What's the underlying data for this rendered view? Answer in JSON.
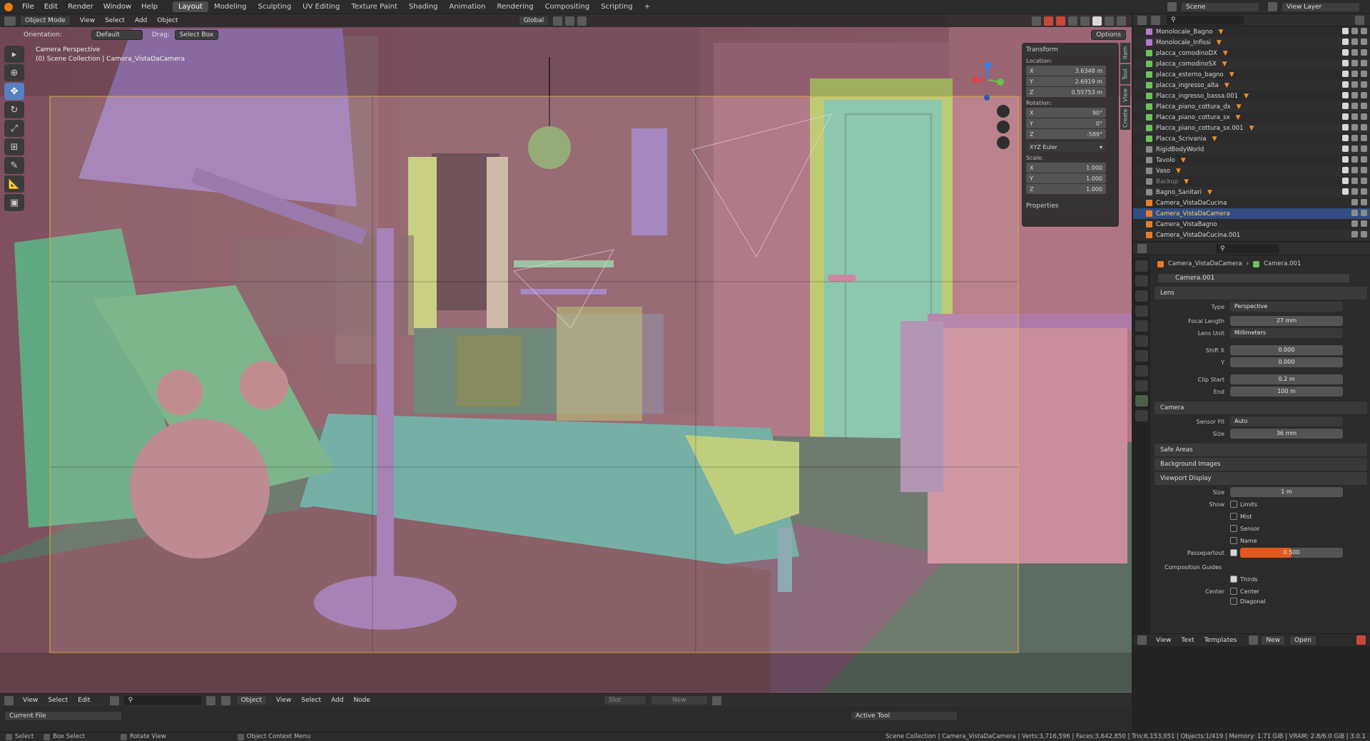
{
  "topbar": {
    "menus": [
      "File",
      "Edit",
      "Render",
      "Window",
      "Help"
    ],
    "workspaces": [
      "Layout",
      "Modeling",
      "Sculpting",
      "UV Editing",
      "Texture Paint",
      "Shading",
      "Animation",
      "Rendering",
      "Compositing",
      "Scripting"
    ],
    "active_workspace": "Layout",
    "add_tab": "+",
    "scene_label": "Scene",
    "view_layer_label": "View Layer"
  },
  "viewport_header": {
    "mode": "Object Mode",
    "menus": [
      "View",
      "Select",
      "Add",
      "Object"
    ],
    "transform_orientation": "Global",
    "orientation_label": "Orientation:",
    "orientation_value": "Default",
    "drag_label": "Drag:",
    "drag_value": "Select Box",
    "options": "Options"
  },
  "viewport": {
    "camera_view": "Camera Perspective",
    "collection_path": "(0) Scene Collection | Camera_VistaDaCamera",
    "gizmo_x": "X",
    "gizmo_y": "Y",
    "gizmo_z": "Z"
  },
  "npanel": {
    "header": "Transform",
    "location_label": "Location:",
    "location": [
      {
        "axis": "X",
        "value": "3.6348 m"
      },
      {
        "axis": "Y",
        "value": "2.6919 m"
      },
      {
        "axis": "Z",
        "value": "0.55753 m"
      }
    ],
    "rotation_label": "Rotation:",
    "rotation": [
      {
        "axis": "X",
        "value": "90°"
      },
      {
        "axis": "Y",
        "value": "0°"
      },
      {
        "axis": "Z",
        "value": "-589°"
      }
    ],
    "rotation_mode": "XYZ Euler",
    "scale_label": "Scale:",
    "scale": [
      {
        "axis": "X",
        "value": "1.000"
      },
      {
        "axis": "Y",
        "value": "1.000"
      },
      {
        "axis": "Z",
        "value": "1.000"
      }
    ],
    "properties": "Properties",
    "tabs": [
      "Item",
      "Tool",
      "View",
      "Create"
    ]
  },
  "outliner": {
    "rows": [
      {
        "name": "Monolocale_Bagno",
        "color": "#b07cc8",
        "selected": false
      },
      {
        "name": "Monolocale_Infissi",
        "color": "#b07cc8",
        "selected": false
      },
      {
        "name": "placca_comodinoDX",
        "color": "#6ec25a",
        "selected": false
      },
      {
        "name": "placca_comodinoSX",
        "color": "#6ec25a",
        "selected": false
      },
      {
        "name": "placca_esterno_bagno",
        "color": "#6ec25a",
        "selected": false
      },
      {
        "name": "placca_ingresso_alta",
        "color": "#6ec25a",
        "selected": false
      },
      {
        "name": "Placca_ingresso_bassa.001",
        "color": "#6ec25a",
        "selected": false
      },
      {
        "name": "Placca_piano_cottura_dx",
        "color": "#6ec25a",
        "selected": false
      },
      {
        "name": "Placca_piano_cottura_sx",
        "color": "#6ec25a",
        "selected": false
      },
      {
        "name": "Placca_piano_cottura_sx.001",
        "color": "#6ec25a",
        "selected": false
      },
      {
        "name": "Placca_Scrivania",
        "color": "#6ec25a",
        "selected": false
      },
      {
        "name": "RigidBodyWorld",
        "color": "#8a8a8a",
        "selected": false
      },
      {
        "name": "Tavolo",
        "color": "#8a8a8a",
        "selected": false
      },
      {
        "name": "Vaso",
        "color": "#8a8a8a",
        "selected": false
      },
      {
        "name": "Backup",
        "color": "#8a8a8a",
        "selected": false
      },
      {
        "name": "Bagno_Sanitari",
        "color": "#8a8a8a",
        "selected": false
      },
      {
        "name": "Camera_VistaDaCucina",
        "color": "#e67c2a",
        "selected": false
      },
      {
        "name": "Camera_VistaDaCamera",
        "color": "#e67c2a",
        "selected": true
      },
      {
        "name": "Camera_VistaBagno",
        "color": "#e67c2a",
        "selected": false
      },
      {
        "name": "Camera_VistaDaCucina.001",
        "color": "#e67c2a",
        "selected": false
      }
    ]
  },
  "properties": {
    "breadcrumb_object": "Camera_VistaDaCamera",
    "breadcrumb_data": "Camera.001",
    "datablock": "Camera.001",
    "lens_section": "Lens",
    "type_label": "Type",
    "type_value": "Perspective",
    "focal_label": "Focal Length",
    "focal_value": "27 mm",
    "lens_unit_label": "Lens Unit",
    "lens_unit_value": "Millimeters",
    "shiftx_label": "Shift X",
    "shiftx_value": "0.000",
    "shifty_label": "Y",
    "shifty_value": "0.000",
    "clip_start_label": "Clip Start",
    "clip_start_value": "0.2 m",
    "clip_end_label": "End",
    "clip_end_value": "100 m",
    "camera_section": "Camera",
    "sensor_fit_label": "Sensor Fit",
    "sensor_fit_value": "Auto",
    "size_label": "Size",
    "size_value": "36 mm",
    "safe_areas": "Safe Areas",
    "background_images": "Background Images",
    "viewport_display": "Viewport Display",
    "vd_size_label": "Size",
    "vd_size_value": "1 m",
    "show_label": "Show",
    "show_limits": "Limits",
    "show_mist": "Mist",
    "show_sensor": "Sensor",
    "show_name": "Name",
    "passepartout_label": "Passepartout",
    "passepartout_value": "0.500",
    "passepartout_fraction": 0.5,
    "composition_guides": "Composition Guides",
    "thirds": "Thirds",
    "center_label": "Center",
    "center": "Center",
    "diagonal": "Diagonal"
  },
  "props_footer": {
    "menus": [
      "View",
      "Text",
      "Templates"
    ],
    "new": "New",
    "open": "Open"
  },
  "bottom_editor": {
    "menus": [
      "View",
      "Select",
      "Edit"
    ],
    "node_menus": [
      "View",
      "Select",
      "Add",
      "Node"
    ],
    "object_value": "Object",
    "slot": "Slot",
    "new": "New",
    "current_file": "Current File",
    "active_tool": "Active Tool",
    "select_box": "Select Box"
  },
  "statusbar": {
    "select": "Select",
    "box_select": "Box Select",
    "rotate_view": "Rotate View",
    "context_menu": "Object Context Menu",
    "stats": "Scene Collection | Camera_VistaDaCamera | Verts:3,716,596 | Faces:3,642,850 | Tris:6,153,051 | Objects:1/419 | Memory: 1.71 GiB | VRAM: 2.8/6.0 GiB | 3.0.1"
  },
  "colors": {
    "accent_selected": "#334d80",
    "active_tool": "#5680c2",
    "camera_frame": "#e0b040",
    "passepartout_bar": "#e2581d"
  }
}
